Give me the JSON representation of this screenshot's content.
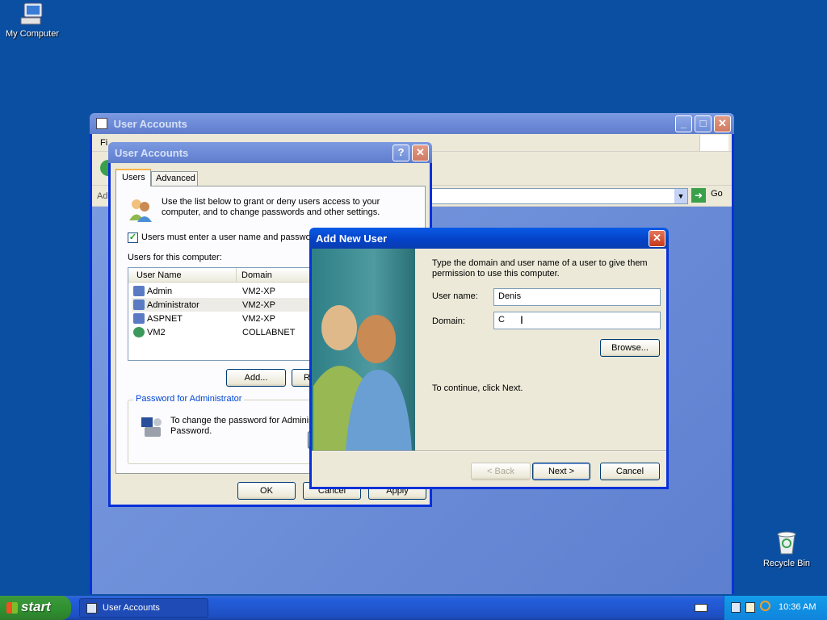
{
  "desktop": {
    "my_computer": "My Computer",
    "recycle_bin": "Recycle Bin"
  },
  "bg_window": {
    "title": "User Accounts",
    "menu_partial": "Fi",
    "address_partial": "Ad",
    "go_label": "Go"
  },
  "ua_dialog": {
    "title": "User Accounts",
    "tabs": [
      "Users",
      "Advanced"
    ],
    "intro": "Use the list below to grant or deny users access to your computer, and to change passwords and other settings.",
    "checkbox_label": "Users must enter a user name and password",
    "users_label": "Users for this computer:",
    "columns": [
      "User Name",
      "Domain"
    ],
    "rows": [
      {
        "name": "Admin",
        "domain": "VM2-XP"
      },
      {
        "name": "Administrator",
        "domain": "VM2-XP"
      },
      {
        "name": "ASPNET",
        "domain": "VM2-XP"
      },
      {
        "name": "VM2",
        "domain": "COLLABNET"
      }
    ],
    "add_button": "Add...",
    "remove_partial": "R",
    "password_group": "Password for Administrator",
    "password_text": "To change the password for Adminis Password.",
    "ok": "OK",
    "cancel": "Cancel",
    "apply": "Apply"
  },
  "add_user": {
    "title": "Add New User",
    "instruction": "Type the domain and user name of a user to give them permission to use this computer.",
    "username_label": "User name:",
    "username_value": "Denis",
    "domain_label": "Domain:",
    "domain_value": "C",
    "browse": "Browse...",
    "continue_text": "To continue, click Next.",
    "back": "< Back",
    "next": "Next >",
    "cancel": "Cancel"
  },
  "taskbar": {
    "start": "start",
    "task": "User Accounts",
    "clock": "10:36 AM"
  },
  "colors": {
    "desktop": "#0b4fa3",
    "titlebar": "#0a5ae6",
    "dialog_face": "#ece9d8",
    "selection_text": "#0046d5"
  }
}
